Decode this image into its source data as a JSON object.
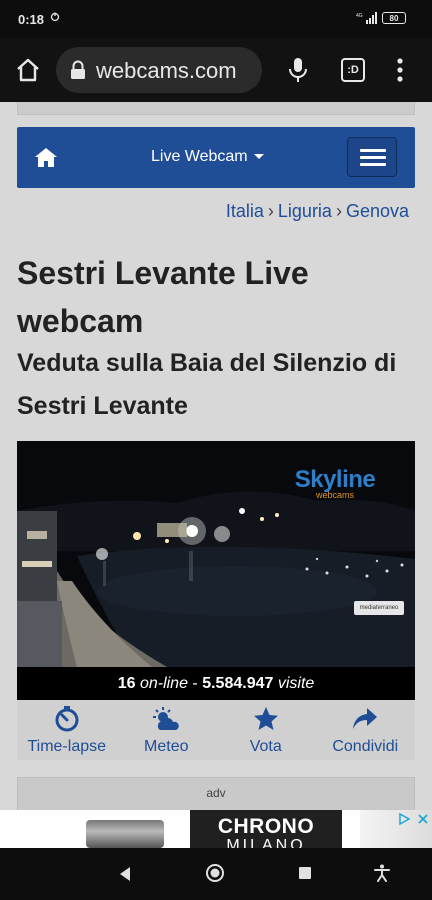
{
  "status": {
    "time": "0:18",
    "network": "4G",
    "battery": "80"
  },
  "browser": {
    "url": "webcams.com",
    "tab_count": ":D"
  },
  "navbar": {
    "title": "Live Webcam"
  },
  "breadcrumb": [
    "Italia",
    "Liguria",
    "Genova"
  ],
  "page": {
    "title": "Sestri Levante Live webcam",
    "subtitle": "Veduta sulla Baia del Silenzio di Sestri Levante"
  },
  "webcam": {
    "logo_main": "Skyline",
    "logo_sub": "webcams",
    "partner_logo": "mediaterraneo"
  },
  "stats": {
    "online_count": "16",
    "online_label": "on-line",
    "separator": "-",
    "visits_count": "5.584.947",
    "visits_label": "visite"
  },
  "actions": [
    {
      "label": "Time-lapse",
      "icon": "timer-icon"
    },
    {
      "label": "Meteo",
      "icon": "weather-icon"
    },
    {
      "label": "Vota",
      "icon": "star-icon"
    },
    {
      "label": "Condividi",
      "icon": "share-icon"
    }
  ],
  "adv_label": "adv",
  "ad_banner": {
    "line1": "CHRONO",
    "line2": "MILANO"
  },
  "colors": {
    "navbar": "#1f4d96",
    "link": "#1f4d96",
    "page_bg": "#d8d8d8"
  }
}
